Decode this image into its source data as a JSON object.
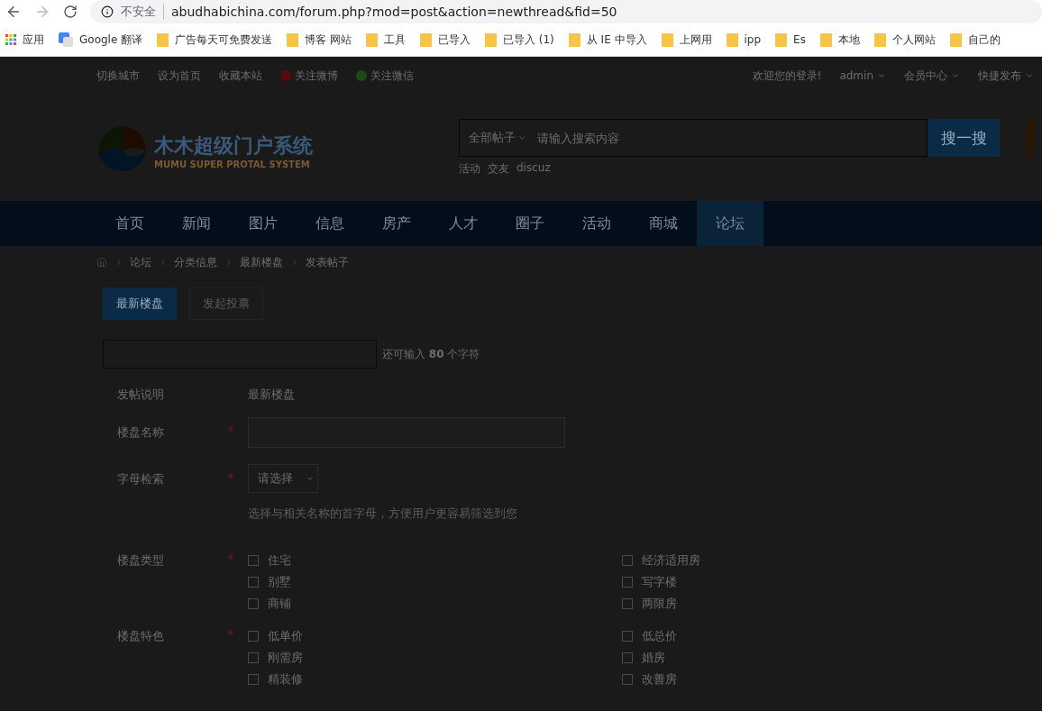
{
  "browser": {
    "security": "不安全",
    "url": "abudhabichina.com/forum.php?mod=post&action=newthread&fid=50",
    "bookmarks": [
      {
        "label": "应用",
        "kind": "apps"
      },
      {
        "label": "Google 翻译",
        "kind": "translate"
      },
      {
        "label": "广告每天可免费发送",
        "kind": "folder"
      },
      {
        "label": "博客 网站",
        "kind": "folder"
      },
      {
        "label": "工具",
        "kind": "folder"
      },
      {
        "label": "已导入",
        "kind": "folder"
      },
      {
        "label": "已导入 (1)",
        "kind": "folder"
      },
      {
        "label": "从 IE 中导入",
        "kind": "folder"
      },
      {
        "label": "上网用",
        "kind": "folder"
      },
      {
        "label": "ipp",
        "kind": "folder"
      },
      {
        "label": "Es",
        "kind": "folder"
      },
      {
        "label": "本地",
        "kind": "folder"
      },
      {
        "label": "个人网站",
        "kind": "folder"
      },
      {
        "label": "自己的",
        "kind": "folder"
      }
    ]
  },
  "topbar": {
    "left": [
      {
        "label": "切换城市",
        "kind": "text"
      },
      {
        "label": "设为首页",
        "kind": "text"
      },
      {
        "label": "收藏本站",
        "kind": "text"
      },
      {
        "label": "关注微博",
        "kind": "weibo"
      },
      {
        "label": "关注微信",
        "kind": "wechat"
      }
    ],
    "right": [
      {
        "label": "欢迎您的登录!",
        "kind": "text"
      },
      {
        "label": "admin",
        "kind": "menu"
      },
      {
        "label": "会员中心",
        "kind": "menu"
      },
      {
        "label": "快捷发布",
        "kind": "menu"
      }
    ]
  },
  "logo": {
    "title": "木木超级门户系统",
    "subtitle": "MUMU SUPER PROTAL SYSTEM"
  },
  "search": {
    "scope": "全部帖子",
    "placeholder": "请输入搜索内容",
    "button": "搜一搜",
    "hot": [
      "活动",
      "交友",
      "discuz"
    ]
  },
  "nav": [
    {
      "label": "首页",
      "selected": false
    },
    {
      "label": "新闻",
      "selected": false
    },
    {
      "label": "图片",
      "selected": false
    },
    {
      "label": "信息",
      "selected": false
    },
    {
      "label": "房产",
      "selected": false
    },
    {
      "label": "人才",
      "selected": false
    },
    {
      "label": "圈子",
      "selected": false
    },
    {
      "label": "活动",
      "selected": false
    },
    {
      "label": "商城",
      "selected": false
    },
    {
      "label": "论坛",
      "selected": true
    }
  ],
  "breadcrumb": [
    "论坛",
    "分类信息",
    "最新楼盘",
    "发表帖子"
  ],
  "tabs": [
    {
      "label": "最新楼盘",
      "selected": true
    },
    {
      "label": "发起投票",
      "selected": false
    }
  ],
  "title_hint": "还可输入 **80** 个字符",
  "form": [
    {
      "label": "发帖说明",
      "kind": "text",
      "required": false,
      "value": "最新楼盘"
    },
    {
      "label": "楼盘名称",
      "kind": "input",
      "required": true
    },
    {
      "label": "字母检索",
      "kind": "select",
      "required": true,
      "value": "请选择",
      "hint": "选择与相关名称的首字母，方便用户更容易筛选到您"
    },
    {
      "label": "楼盘类型",
      "kind": "checks",
      "required": true,
      "options": [
        {
          "label": "住宅",
          "checked": false
        },
        {
          "label": "经济适用房",
          "checked": false
        },
        {
          "label": "别墅",
          "checked": false
        },
        {
          "label": "写字楼",
          "checked": false
        },
        {
          "label": "商铺",
          "checked": false
        },
        {
          "label": "两限房",
          "checked": false
        }
      ]
    },
    {
      "label": "楼盘特色",
      "kind": "checks",
      "required": true,
      "options": [
        {
          "label": "低单价",
          "checked": false
        },
        {
          "label": "低总价",
          "checked": false
        },
        {
          "label": "刚需房",
          "checked": false
        },
        {
          "label": "婚房",
          "checked": false
        },
        {
          "label": "精装修",
          "checked": false
        },
        {
          "label": "改善房",
          "checked": false
        }
      ]
    }
  ]
}
